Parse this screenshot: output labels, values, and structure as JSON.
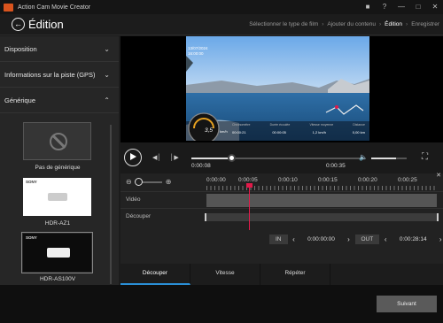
{
  "app": {
    "title": "Action Cam Movie Creator"
  },
  "header": {
    "title": "Édition",
    "steps": [
      "Sélectionner le type de film",
      "Ajouter du contenu",
      "Édition",
      "Enregistrer"
    ],
    "active_step": "Édition"
  },
  "sidebar": {
    "sections": [
      "Disposition",
      "Informations sur la piste (GPS)",
      "Générique"
    ],
    "templates": [
      "Pas de générique",
      "HDR-AZ1",
      "HDR-AS100V"
    ],
    "brand": "SONY"
  },
  "video": {
    "overlay_date": "13/07/2024",
    "overlay_time": "16:00:00",
    "speed_value": "3,5",
    "speed_unit": "km/h",
    "stat_labels": [
      "Chronomètre",
      "Durée écoulée",
      "Vitesse moyenne",
      "Distance"
    ],
    "stat_values": [
      "00:00:21",
      "00:00:05",
      "1,2 km/h",
      "0,00 km"
    ]
  },
  "playback": {
    "current": "0:00:08",
    "total": "0:00:35",
    "progress": 0.23,
    "volume": 0.7
  },
  "timeline": {
    "ticks": [
      "0:00:00",
      "0:00:05",
      "0:00:10",
      "0:00:15",
      "0:00:20",
      "0:00:25"
    ],
    "tracks": [
      "Vidéo",
      "Découper"
    ],
    "in_label": "IN",
    "in_time": "0:00:00:00",
    "out_label": "OUT",
    "out_time": "0:00:28:14"
  },
  "tabs": [
    "Découper",
    "Vitesse",
    "Répéter"
  ],
  "footer": {
    "next_label": "Suivant"
  },
  "colors": {
    "accent": "#2a8fd6",
    "playhead": "#e11a4a",
    "app_icon": "#d9541e"
  }
}
